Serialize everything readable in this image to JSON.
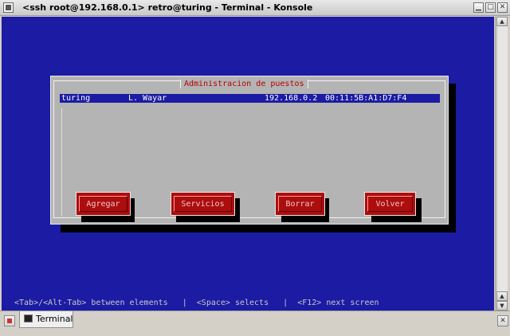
{
  "window": {
    "title": "<ssh root@192.168.0.1> retro@turing - Terminal - Konsole",
    "minimize_glyph": "▁",
    "maximize_glyph": "□",
    "close_glyph": "✕"
  },
  "dialog": {
    "title": "Administracion de puestos",
    "rows": [
      {
        "host": "turing",
        "user": "L. Wayar",
        "ip": "192.168.0.2",
        "mac": "00:11:5B:A1:D7:F4"
      }
    ],
    "buttons": {
      "add": "Agregar",
      "services": "Servicios",
      "delete": "Borrar",
      "back": "Volver"
    }
  },
  "statusline": "<Tab>/<Alt-Tab> between elements   |  <Space> selects   |  <F12> next screen",
  "taskbar": {
    "tab_label": "Terminal",
    "close_glyph": "✕"
  },
  "colors": {
    "terminal_bg": "#1b1ba4",
    "dialog_bg": "#b4b4b4",
    "button_bg": "#ad0d0d",
    "title_text": "#b70000"
  },
  "icons": {
    "window_menu": "window-menu-icon",
    "new_tab": "new-tab-icon",
    "terminal": "terminal-icon"
  }
}
